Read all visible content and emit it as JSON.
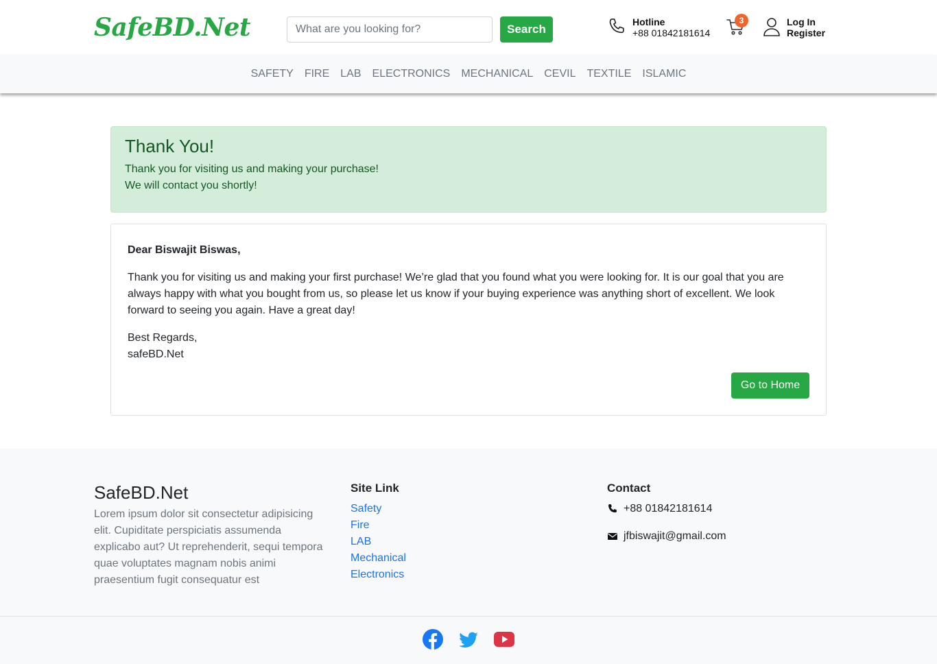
{
  "header": {
    "logo": "SafeBD.Net",
    "search": {
      "placeholder": "What are you looking for?",
      "button": "Search"
    },
    "hotline": {
      "label": "Hotline",
      "number": "+88 01842181614"
    },
    "cart": {
      "count": "3"
    },
    "auth": {
      "login": "Log In",
      "register": "Register"
    }
  },
  "categories": [
    "SAFETY",
    "FIRE",
    "LAB",
    "ELECTRONICS",
    "MECHANICAL",
    "CEVIL",
    "TEXTILE",
    "ISLAMIC"
  ],
  "alert": {
    "title": "Thank You!",
    "line1": "Thank you for visiting us and making your purchase!",
    "line2": "We will contact you shortly!"
  },
  "letter": {
    "greeting": "Dear Biswajit Biswas,",
    "body": "Thank you for visiting us and making your first purchase! We’re glad that you found what you were looking for. It is our goal that you are always happy with what you bought from us, so please let us know if your buying experience was anything short of excellent. We look forward to seeing you again. Have a great day!",
    "regards": "Best Regards,",
    "signature": "safeBD.Net",
    "home_button": "Go to Home"
  },
  "footer": {
    "brand": "SafeBD.Net",
    "description": "Lorem ipsum dolor sit consectetur adipisicing elit. Cupiditate perspiciatis assumenda explicabo aut? Ut reprehenderit, sequi tempora quae voluptates magnam nobis animi praesentium fugit consequatur est",
    "site_link_title": "Site Link",
    "site_links": [
      "Safety",
      "Fire",
      "LAB",
      "Mechanical",
      "Electronics"
    ],
    "contact_title": "Contact",
    "phone": "+88 01842181614",
    "email": "jfbiswajit@gmail.com",
    "social": [
      "facebook-icon",
      "twitter-icon",
      "youtube-icon"
    ]
  },
  "colors": {
    "primary_green": "#28a745",
    "link_blue": "#1a73e8",
    "badge_orange": "#f0642d",
    "facebook": "#1877f2",
    "twitter": "#1da1f2",
    "youtube": "#dc3545"
  }
}
